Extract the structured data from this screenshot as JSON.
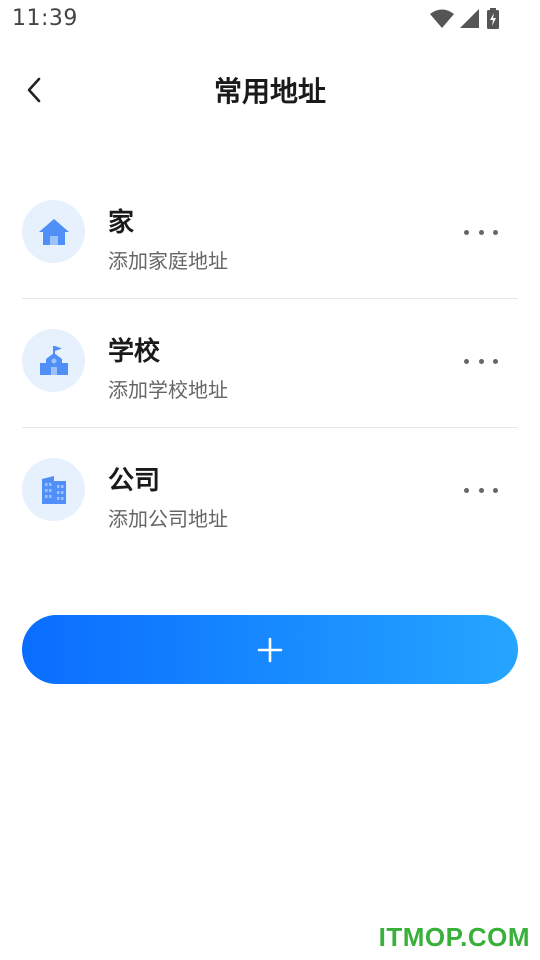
{
  "status_bar": {
    "time": "11:39",
    "icons": [
      "wifi-icon",
      "cell-signal-icon",
      "battery-charging-icon"
    ]
  },
  "nav": {
    "back_icon": "chevron-left-icon",
    "title": "常用地址"
  },
  "addresses": [
    {
      "icon": "home-icon",
      "title": "家",
      "subtitle": "添加家庭地址"
    },
    {
      "icon": "school-icon",
      "title": "学校",
      "subtitle": "添加学校地址"
    },
    {
      "icon": "office-building-icon",
      "title": "公司",
      "subtitle": "添加公司地址"
    }
  ],
  "add_button": {
    "icon": "plus-icon",
    "gradient": [
      "#0a6dff",
      "#25a5ff"
    ]
  },
  "colors": {
    "accent": "#0a6dff",
    "icon_bg": "#e7f1fe",
    "icon_fg": "#4f8ff7",
    "watermark": "#38b03a"
  },
  "watermark": "ITMOP.COM"
}
